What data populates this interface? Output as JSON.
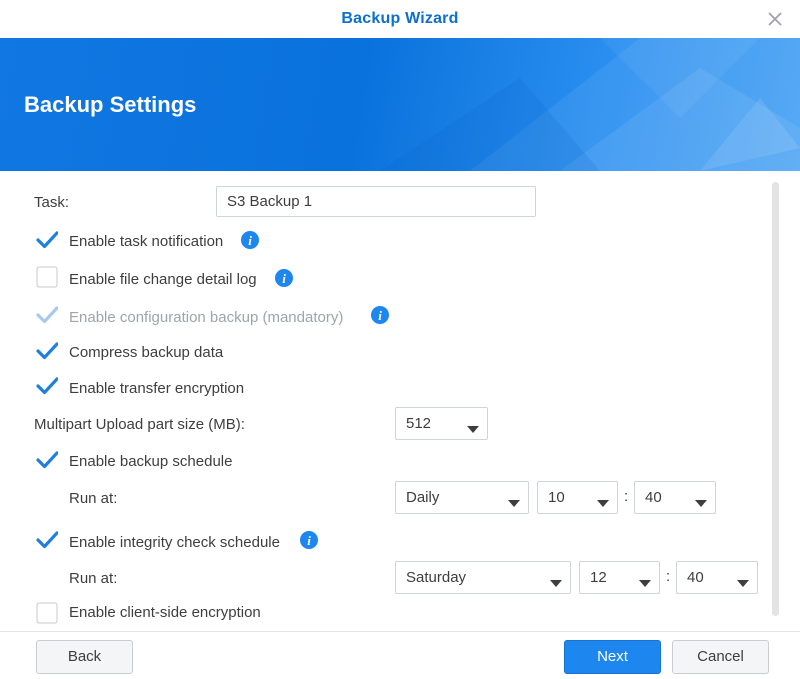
{
  "window": {
    "title": "Backup Wizard"
  },
  "banner": {
    "heading": "Backup Settings"
  },
  "task": {
    "label": "Task:",
    "value": "S3 Backup 1"
  },
  "options": {
    "task_notification": {
      "label": "Enable task notification",
      "checked": true
    },
    "file_change_log": {
      "label": "Enable file change detail log",
      "checked": false
    },
    "config_backup": {
      "label": "Enable configuration backup (mandatory)",
      "checked": true,
      "disabled": true
    },
    "compress": {
      "label": "Compress backup data",
      "checked": true
    },
    "transfer_encryption": {
      "label": "Enable transfer encryption",
      "checked": true
    },
    "backup_schedule": {
      "label": "Enable backup schedule",
      "checked": true
    },
    "integrity_schedule": {
      "label": "Enable integrity check schedule",
      "checked": true
    },
    "client_encryption": {
      "label": "Enable client-side encryption",
      "checked": false
    }
  },
  "multipart": {
    "label": "Multipart Upload part size (MB):",
    "value": "512"
  },
  "backup_run": {
    "label": "Run at:",
    "frequency": "Daily",
    "hour": "10",
    "separator": ":",
    "minute": "40"
  },
  "integrity_run": {
    "label": "Run at:",
    "day": "Saturday",
    "hour": "12",
    "separator": ":",
    "minute": "40"
  },
  "footer": {
    "back": "Back",
    "next": "Next",
    "cancel": "Cancel"
  },
  "colors": {
    "accent": "#1d86ef",
    "title": "#0b6fcf",
    "check": "#1f7fe0"
  }
}
